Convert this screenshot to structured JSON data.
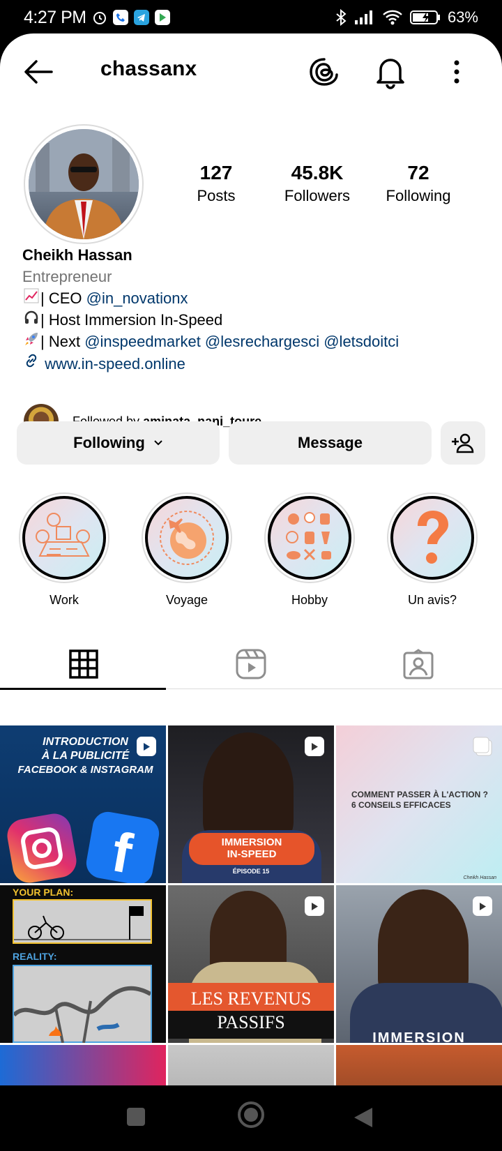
{
  "status_bar": {
    "time": "4:27 PM",
    "battery": "63%"
  },
  "header": {
    "username": "chassanx"
  },
  "profile": {
    "posts_count": "127",
    "posts_label": "Posts",
    "followers_count": "45.8K",
    "followers_label": "Followers",
    "following_count": "72",
    "following_label": "Following",
    "name": "Cheikh Hassan",
    "category": "Entrepreneur",
    "bio_line1_prefix": "| CEO ",
    "bio_line1_mention": "@in_novationx",
    "bio_line2": "| Host Immersion In-Speed",
    "bio_line3_prefix": "| Next ",
    "bio_line3_mentions": "@inspeedmarket @lesrechargesci @letsdoitci",
    "website": "www.in-speed.online",
    "followed_by_prefix": "Followed by ",
    "followed_by_user": "aminata_nani_toure"
  },
  "buttons": {
    "following": "Following",
    "message": "Message"
  },
  "highlights": [
    {
      "label": "Work"
    },
    {
      "label": "Voyage"
    },
    {
      "label": "Hobby"
    },
    {
      "label": "Un avis?"
    }
  ],
  "posts": [
    {
      "text_lines": [
        "INTRODUCTION",
        "À LA PUBLICITÉ",
        "FACEBOOK & INSTAGRAM"
      ]
    },
    {
      "text_lines": [
        "IMMERSION",
        "IN-SPEED",
        "ÉPISODE 15"
      ]
    },
    {
      "text_lines": [
        "COMMENT PASSER À L'ACTION ?",
        "6 CONSEILS EFFICACES"
      ],
      "signature": "Cheikh Hassan"
    },
    {
      "text_lines": [
        "YOUR PLAN:",
        "REALITY:"
      ]
    },
    {
      "text_lines": [
        "LES REVENUS",
        "PASSIFS"
      ]
    },
    {
      "text_lines": [
        "IMMERSION"
      ]
    }
  ],
  "colors": {
    "link": "#00376b",
    "button_bg": "#efefef",
    "secondary_text": "#737373"
  }
}
